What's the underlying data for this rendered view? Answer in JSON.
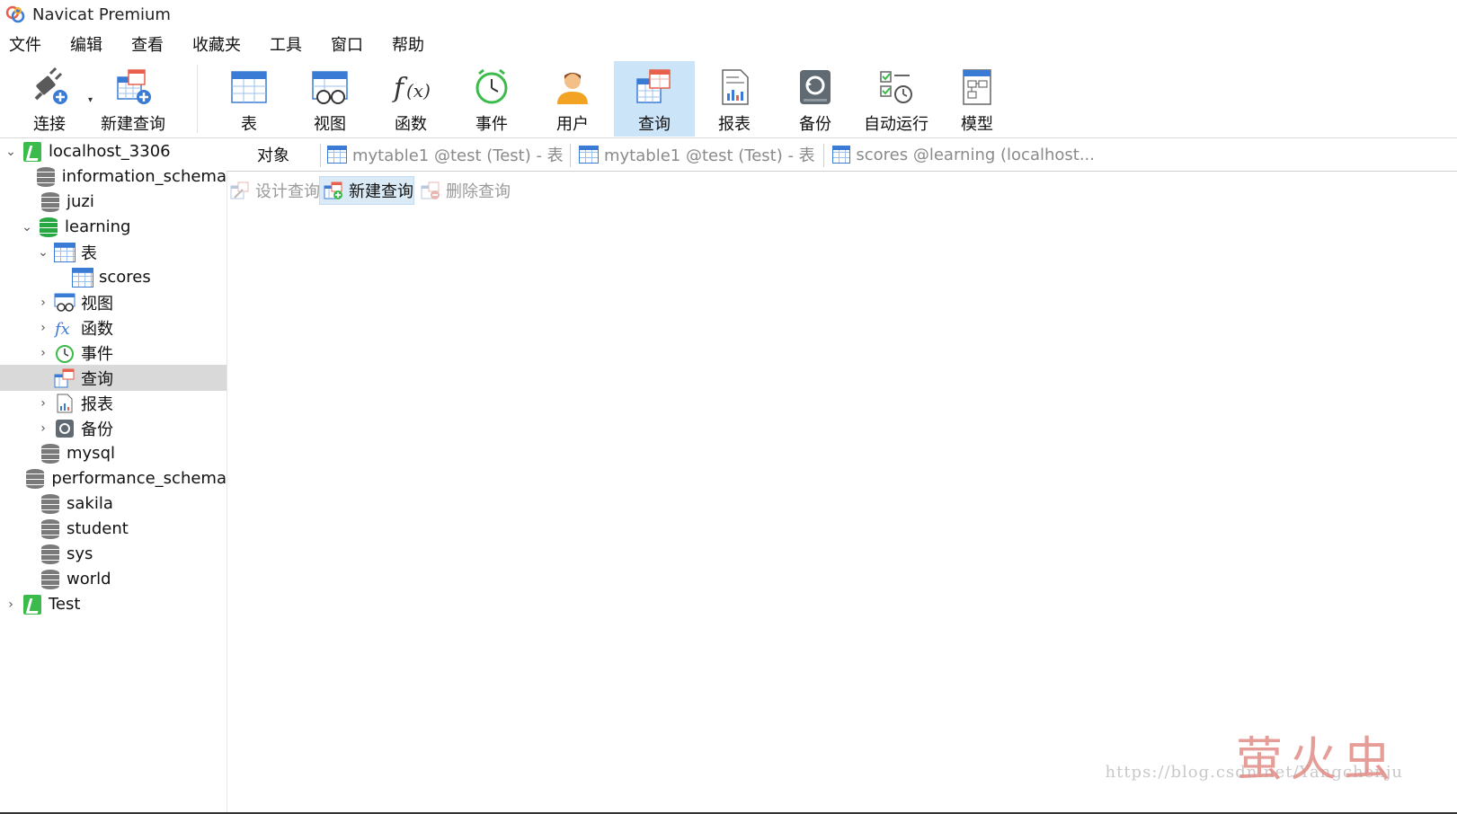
{
  "window": {
    "title": "Navicat Premium"
  },
  "menu": [
    "文件",
    "编辑",
    "查看",
    "收藏夹",
    "工具",
    "窗口",
    "帮助"
  ],
  "toolbar": [
    {
      "id": "connect",
      "label": "连接",
      "icon": "plug-icon"
    },
    {
      "id": "new-query",
      "label": "新建查询",
      "icon": "new-query-icon"
    },
    {
      "id": "table",
      "label": "表",
      "icon": "table-icon"
    },
    {
      "id": "view",
      "label": "视图",
      "icon": "view-icon"
    },
    {
      "id": "function",
      "label": "函数",
      "icon": "function-icon"
    },
    {
      "id": "event",
      "label": "事件",
      "icon": "clock-icon"
    },
    {
      "id": "user",
      "label": "用户",
      "icon": "user-icon"
    },
    {
      "id": "query",
      "label": "查询",
      "icon": "query-icon",
      "active": true
    },
    {
      "id": "report",
      "label": "报表",
      "icon": "report-icon"
    },
    {
      "id": "backup",
      "label": "备份",
      "icon": "backup-icon"
    },
    {
      "id": "automation",
      "label": "自动运行",
      "icon": "automation-icon"
    },
    {
      "id": "model",
      "label": "模型",
      "icon": "model-icon"
    }
  ],
  "tree": [
    {
      "label": "localhost_3306",
      "kind": "connection",
      "expanded": true
    },
    {
      "label": "information_schema",
      "kind": "database"
    },
    {
      "label": "juzi",
      "kind": "database"
    },
    {
      "label": "learning",
      "kind": "database-open",
      "expanded": true
    },
    {
      "label": "表",
      "kind": "tables",
      "expanded": true
    },
    {
      "label": "scores",
      "kind": "table"
    },
    {
      "label": "视图",
      "kind": "views"
    },
    {
      "label": "函数",
      "kind": "functions"
    },
    {
      "label": "事件",
      "kind": "events"
    },
    {
      "label": "查询",
      "kind": "queries",
      "selected": true
    },
    {
      "label": "报表",
      "kind": "reports"
    },
    {
      "label": "备份",
      "kind": "backups"
    },
    {
      "label": "mysql",
      "kind": "database"
    },
    {
      "label": "performance_schema",
      "kind": "database"
    },
    {
      "label": "sakila",
      "kind": "database"
    },
    {
      "label": "student",
      "kind": "database"
    },
    {
      "label": "sys",
      "kind": "database"
    },
    {
      "label": "world",
      "kind": "database"
    },
    {
      "label": "Test",
      "kind": "connection"
    }
  ],
  "tabs": {
    "objects": "对象",
    "open": [
      "mytable1 @test (Test) - 表",
      "mytable1 @test (Test) - 表",
      "scores @learning (localhost..."
    ]
  },
  "object_toolbar": {
    "design": "设计查询",
    "new": "新建查询",
    "delete": "删除查询"
  },
  "watermark": {
    "text": "萤火虫",
    "url": "https://blog.csdn.net/Yangchenju"
  },
  "colors": {
    "accent": "#3a7bd5",
    "active_tool_bg": "#cce4f7",
    "selected_row_bg": "#d9d9d9",
    "green": "#27a844"
  }
}
